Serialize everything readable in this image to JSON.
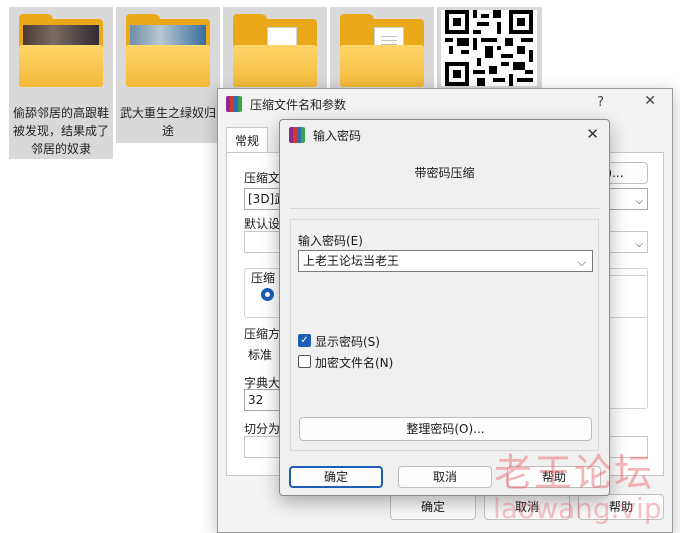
{
  "explorer": {
    "tiles": [
      {
        "label": "偷舔邻居的高跟鞋被发现，结果成了邻居的奴隶"
      },
      {
        "label": "武大重生之绿奴归途"
      },
      {
        "label": ""
      },
      {
        "label": ""
      }
    ]
  },
  "main_dialog": {
    "title": "压缩文件名和参数",
    "help": "?",
    "close": "✕",
    "tab_general": "常规",
    "archive_name_label": "压缩文",
    "archive_name_value": "[3D]武",
    "browse_button": "(B)...",
    "default_profile_label": "默认设",
    "format_group_label": "压缩",
    "method_label": "压缩方",
    "method_value": "标准",
    "dict_label": "字典大",
    "dict_value": "32",
    "split_label": "切分为",
    "ok": "确定",
    "cancel": "取消",
    "help_button": "帮助"
  },
  "password_dialog": {
    "title": "输入密码",
    "close": "✕",
    "caption": "带密码压缩",
    "password_label": "输入密码(E)",
    "password_value": "上老王论坛当老王",
    "show_password_label": "显示密码(S)",
    "show_password_checked": true,
    "encrypt_names_label": "加密文件名(N)",
    "encrypt_names_checked": false,
    "organize_button": "整理密码(O)...",
    "ok": "确定",
    "cancel": "取消",
    "help": "帮助"
  },
  "watermark": {
    "line1": "老王论坛",
    "line2": "laowang.vip"
  },
  "colors": {
    "accent": "#1c5fb4",
    "folder": "#f3b939"
  }
}
